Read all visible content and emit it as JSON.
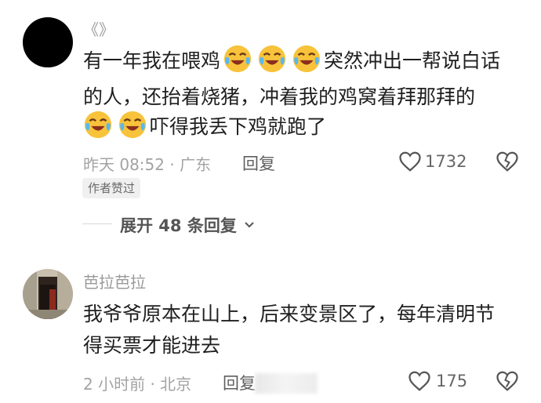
{
  "comments": [
    {
      "username": "《》",
      "content_line1_a": "有一年我在喂鸡",
      "content_line1_b": "突然冲出一帮说白话",
      "content_line2": "的人，还抬着烧猪，冲着我的鸡窝着拜那拜的",
      "content_line3": "吓得我丢下鸡就跑了",
      "meta": "昨天 08:52 · 广东",
      "reply_label": "回复",
      "like_count": "1732",
      "badge": "作者赞过",
      "expand_label": "展开 48 条回复",
      "emoji_icon": "crying-laughing-emoji-icon"
    },
    {
      "username": "芭拉芭拉",
      "content_line1": "我爷爷原本在山上，后来变景区了，每年清明节",
      "content_line2": "得买票才能进去",
      "meta": "2 小时前 · 北京",
      "reply_label": "回复",
      "like_count": "175"
    }
  ],
  "colors": {
    "text": "#1f1f1f",
    "meta": "#a3a3a3",
    "icon": "#555555"
  }
}
